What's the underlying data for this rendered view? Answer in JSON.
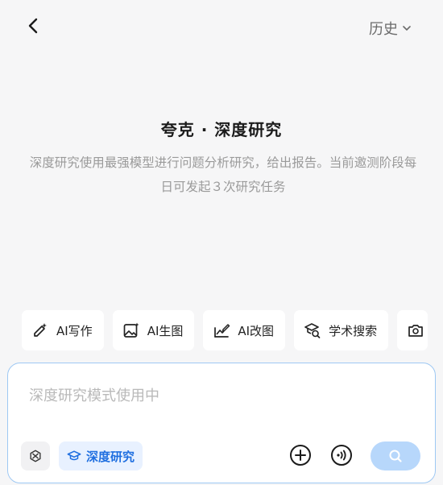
{
  "header": {
    "history_label": "历史"
  },
  "intro": {
    "title": "夸克 · 深度研究",
    "description": "深度研究使用最强模型进行问题分析研究，给出报告。当前邀测阶段每日可发起３次研究任务"
  },
  "tools": [
    {
      "label": "AI写作",
      "icon": "pen-sparkle-icon"
    },
    {
      "label": "AI生图",
      "icon": "image-sparkle-icon"
    },
    {
      "label": "AI改图",
      "icon": "image-edit-icon"
    },
    {
      "label": "学术搜索",
      "icon": "academic-search-icon"
    },
    {
      "label": "",
      "icon": "camera-icon"
    }
  ],
  "composer": {
    "placeholder": "深度研究模式使用中",
    "mode_label": "深度研究"
  },
  "colors": {
    "accent": "#1f6fe0",
    "send_button": "#b7d7fb",
    "input_border": "#9ec8f3"
  }
}
